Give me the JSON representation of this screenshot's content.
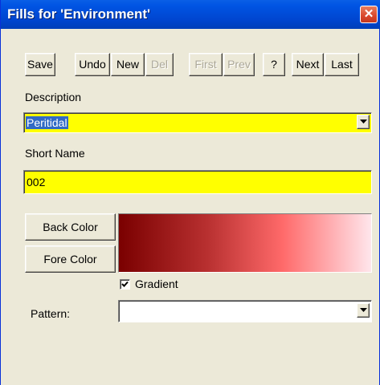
{
  "window": {
    "title": "Fills for 'Environment'",
    "close_glyph": "✕"
  },
  "toolbar": {
    "save": "Save",
    "undo": "Undo",
    "new": "New",
    "del": "Del",
    "first": "First",
    "prev": "Prev",
    "help": "?",
    "next": "Next",
    "last": "Last"
  },
  "description": {
    "label": "Description",
    "value": "Peritidal"
  },
  "short_name": {
    "label": "Short Name",
    "value": "002"
  },
  "colors": {
    "back_color_label": "Back Color",
    "fore_color_label": "Fore Color",
    "back_color": "#7a0000",
    "fore_color": "#ffe6ec"
  },
  "gradient": {
    "label": "Gradient",
    "checked": true
  },
  "pattern": {
    "label": "Pattern:",
    "value": ""
  }
}
